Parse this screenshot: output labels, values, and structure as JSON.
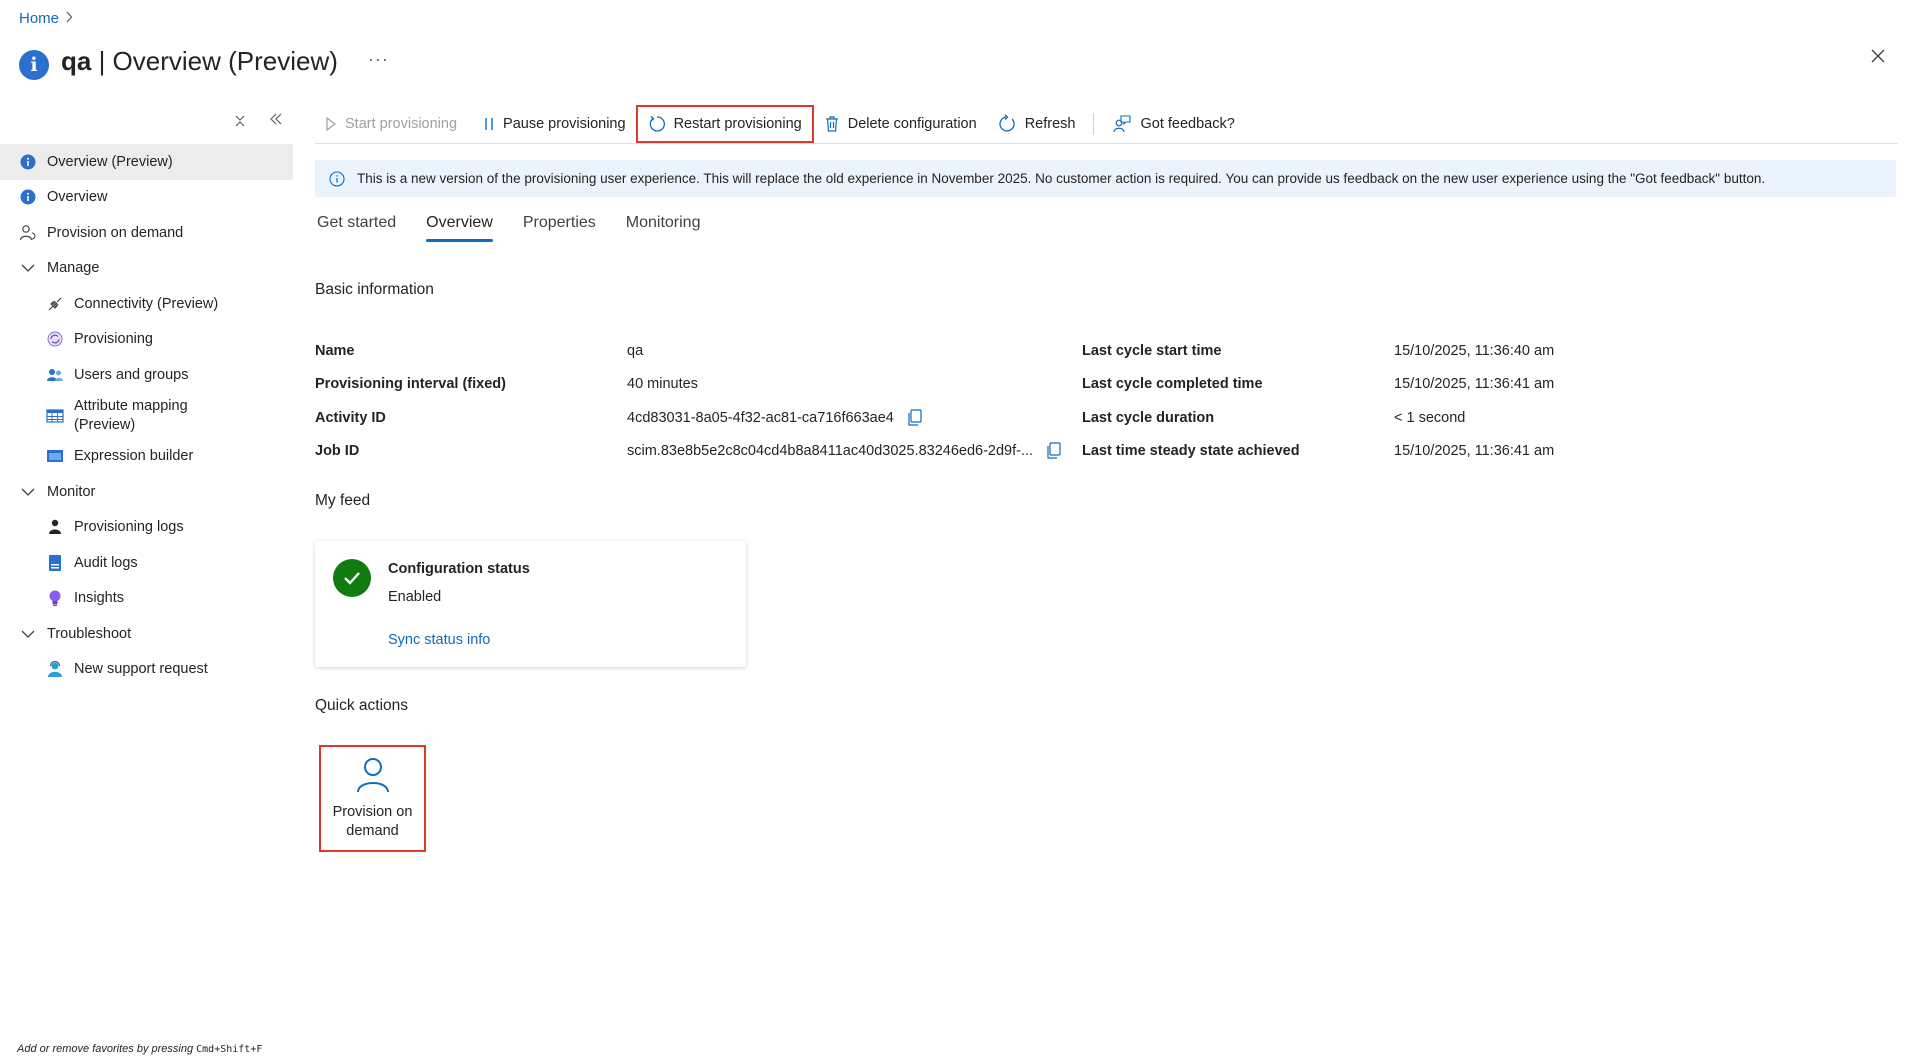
{
  "breadcrumb": {
    "home": "Home",
    "separator": ">"
  },
  "header": {
    "title_name": "qa",
    "title_rest": " | Overview (Preview)",
    "more": "···"
  },
  "sidebar": {
    "items": [
      {
        "label": "Overview (Preview)",
        "icon": "info-icon",
        "active": true
      },
      {
        "label": "Overview",
        "icon": "info-icon"
      },
      {
        "label": "Provision on demand",
        "icon": "person-sync-icon"
      },
      {
        "label": "Manage",
        "icon": "chevron-down-icon",
        "group": true
      },
      {
        "label": "Connectivity (Preview)",
        "icon": "plug-icon"
      },
      {
        "label": "Provisioning",
        "icon": "provisioning-icon"
      },
      {
        "label": "Users and groups",
        "icon": "users-icon"
      },
      {
        "label": "Attribute mapping (Preview)",
        "icon": "table-icon"
      },
      {
        "label": "Expression builder",
        "icon": "expression-icon"
      },
      {
        "label": "Monitor",
        "icon": "chevron-down-icon",
        "group": true
      },
      {
        "label": "Provisioning logs",
        "icon": "person-log-icon"
      },
      {
        "label": "Audit logs",
        "icon": "audit-icon"
      },
      {
        "label": "Insights",
        "icon": "bulb-icon"
      },
      {
        "label": "Troubleshoot",
        "icon": "chevron-down-icon",
        "group": true
      },
      {
        "label": "New support request",
        "icon": "support-icon"
      }
    ],
    "footer_text": "Add or remove favorites by pressing ",
    "footer_shortcut": "Cmd+Shift+F"
  },
  "toolbar": {
    "start": "Start provisioning",
    "pause": "Pause provisioning",
    "restart": "Restart provisioning",
    "delete": "Delete configuration",
    "refresh": "Refresh",
    "feedback": "Got feedback?"
  },
  "banner": {
    "text": "This is a new version of the provisioning user experience. This will replace the old experience in November 2025. No customer action is required. You can provide us feedback on the new user experience using the \"Got feedback\" button."
  },
  "tabs": [
    "Get started",
    "Overview",
    "Properties",
    "Monitoring"
  ],
  "active_tab": "Overview",
  "basic_info": {
    "title": "Basic information",
    "rows": [
      {
        "k1": "Name",
        "v1": "qa",
        "k2": "Last cycle start time",
        "v2": "15/10/2025, 11:36:40 am"
      },
      {
        "k1": "Provisioning interval (fixed)",
        "v1": "40 minutes",
        "k2": "Last cycle completed time",
        "v2": "15/10/2025, 11:36:41 am"
      },
      {
        "k1": "Activity ID",
        "v1": "4cd83031-8a05-4f32-ac81-ca716f663ae4",
        "k2": "Last cycle duration",
        "v2": "< 1 second"
      },
      {
        "k1": "Job ID",
        "v1": "scim.83e8b5e2c8c04cd4b8a8411ac40d3025.83246ed6-2d9f-...",
        "k2": "Last time steady state achieved",
        "v2": "15/10/2025, 11:36:41 am"
      }
    ]
  },
  "feed": {
    "title": "My feed",
    "card_title": "Configuration status",
    "card_status": "Enabled",
    "card_link": "Sync status info"
  },
  "quick_actions": {
    "title": "Quick actions",
    "tile_label": "Provision on demand"
  },
  "colors": {
    "accent": "#0f6cbd",
    "highlight": "#e0382b",
    "success": "#107c10",
    "banner_bg": "#ebf3fc"
  }
}
